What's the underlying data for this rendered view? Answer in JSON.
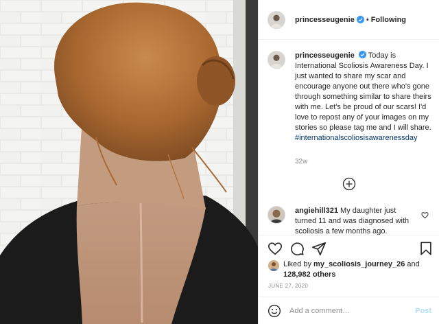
{
  "header": {
    "username": "princesseugenie",
    "separator": "•",
    "follow_status": "Following"
  },
  "caption": {
    "username": "princesseugenie",
    "text": "Today is International Scoliosis Awareness Day. I just wanted to share my scar and encourage anyone out there who's gone through something similar to share theirs with me. Let's be proud of our scars! I'd love to repost any of your images on my stories so please tag me and I will share.",
    "hashtag": "#internationalscoliosisawarenessday",
    "time": "32w"
  },
  "load_more": {
    "icon": "plus-circle-icon"
  },
  "comment": {
    "username": "angiehill321",
    "text": "My daughter just turned 11 and was diagnosed with scoliosis a few months ago."
  },
  "actions": {
    "icons": [
      "heart-icon",
      "comment-icon",
      "share-icon",
      "bookmark-icon"
    ]
  },
  "likes": {
    "prefix": "Liked by",
    "user": "my_scoliosis_journey_26",
    "middle": "and",
    "count": "128,982 others"
  },
  "date": "JUNE 27, 2020",
  "add_comment": {
    "placeholder": "Add a comment…",
    "post_label": "Post"
  },
  "colors": {
    "verified": "#3897f0",
    "hashtag": "#00376b",
    "muted": "#8e8e8e",
    "post_disabled": "#b2dffc"
  }
}
